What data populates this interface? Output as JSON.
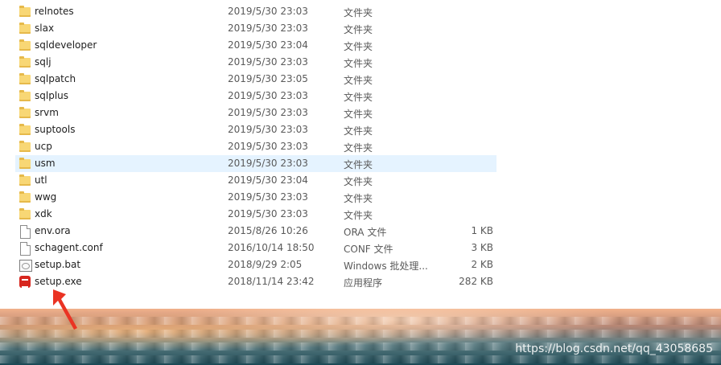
{
  "files": [
    {
      "name": "relnotes",
      "date": "2019/5/30 23:03",
      "type": "文件夹",
      "size": "",
      "icon": "folder-icon",
      "selected": false
    },
    {
      "name": "slax",
      "date": "2019/5/30 23:03",
      "type": "文件夹",
      "size": "",
      "icon": "folder-icon",
      "selected": false
    },
    {
      "name": "sqldeveloper",
      "date": "2019/5/30 23:04",
      "type": "文件夹",
      "size": "",
      "icon": "folder-icon",
      "selected": false
    },
    {
      "name": "sqlj",
      "date": "2019/5/30 23:03",
      "type": "文件夹",
      "size": "",
      "icon": "folder-icon",
      "selected": false
    },
    {
      "name": "sqlpatch",
      "date": "2019/5/30 23:05",
      "type": "文件夹",
      "size": "",
      "icon": "folder-icon",
      "selected": false
    },
    {
      "name": "sqlplus",
      "date": "2019/5/30 23:03",
      "type": "文件夹",
      "size": "",
      "icon": "folder-icon",
      "selected": false
    },
    {
      "name": "srvm",
      "date": "2019/5/30 23:03",
      "type": "文件夹",
      "size": "",
      "icon": "folder-icon",
      "selected": false
    },
    {
      "name": "suptools",
      "date": "2019/5/30 23:03",
      "type": "文件夹",
      "size": "",
      "icon": "folder-icon",
      "selected": false
    },
    {
      "name": "ucp",
      "date": "2019/5/30 23:03",
      "type": "文件夹",
      "size": "",
      "icon": "folder-icon",
      "selected": false
    },
    {
      "name": "usm",
      "date": "2019/5/30 23:03",
      "type": "文件夹",
      "size": "",
      "icon": "folder-icon",
      "selected": true
    },
    {
      "name": "utl",
      "date": "2019/5/30 23:04",
      "type": "文件夹",
      "size": "",
      "icon": "folder-icon",
      "selected": false
    },
    {
      "name": "wwg",
      "date": "2019/5/30 23:03",
      "type": "文件夹",
      "size": "",
      "icon": "folder-icon",
      "selected": false
    },
    {
      "name": "xdk",
      "date": "2019/5/30 23:03",
      "type": "文件夹",
      "size": "",
      "icon": "folder-icon",
      "selected": false
    },
    {
      "name": "env.ora",
      "date": "2015/8/26 10:26",
      "type": "ORA 文件",
      "size": "1 KB",
      "icon": "file-icon",
      "selected": false
    },
    {
      "name": "schagent.conf",
      "date": "2016/10/14 18:50",
      "type": "CONF 文件",
      "size": "3 KB",
      "icon": "file-icon",
      "selected": false
    },
    {
      "name": "setup.bat",
      "date": "2018/9/29 2:05",
      "type": "Windows 批处理...",
      "size": "2 KB",
      "icon": "batch-file-icon",
      "selected": false
    },
    {
      "name": "setup.exe",
      "date": "2018/11/14 23:42",
      "type": "应用程序",
      "size": "282 KB",
      "icon": "exe-icon",
      "selected": false
    }
  ],
  "watermark": "https://blog.csdn.net/qq_43058685",
  "colors": {
    "selected_row": "#e5f3ff",
    "folder": "#f8d775",
    "arrow": "#ea3323"
  }
}
